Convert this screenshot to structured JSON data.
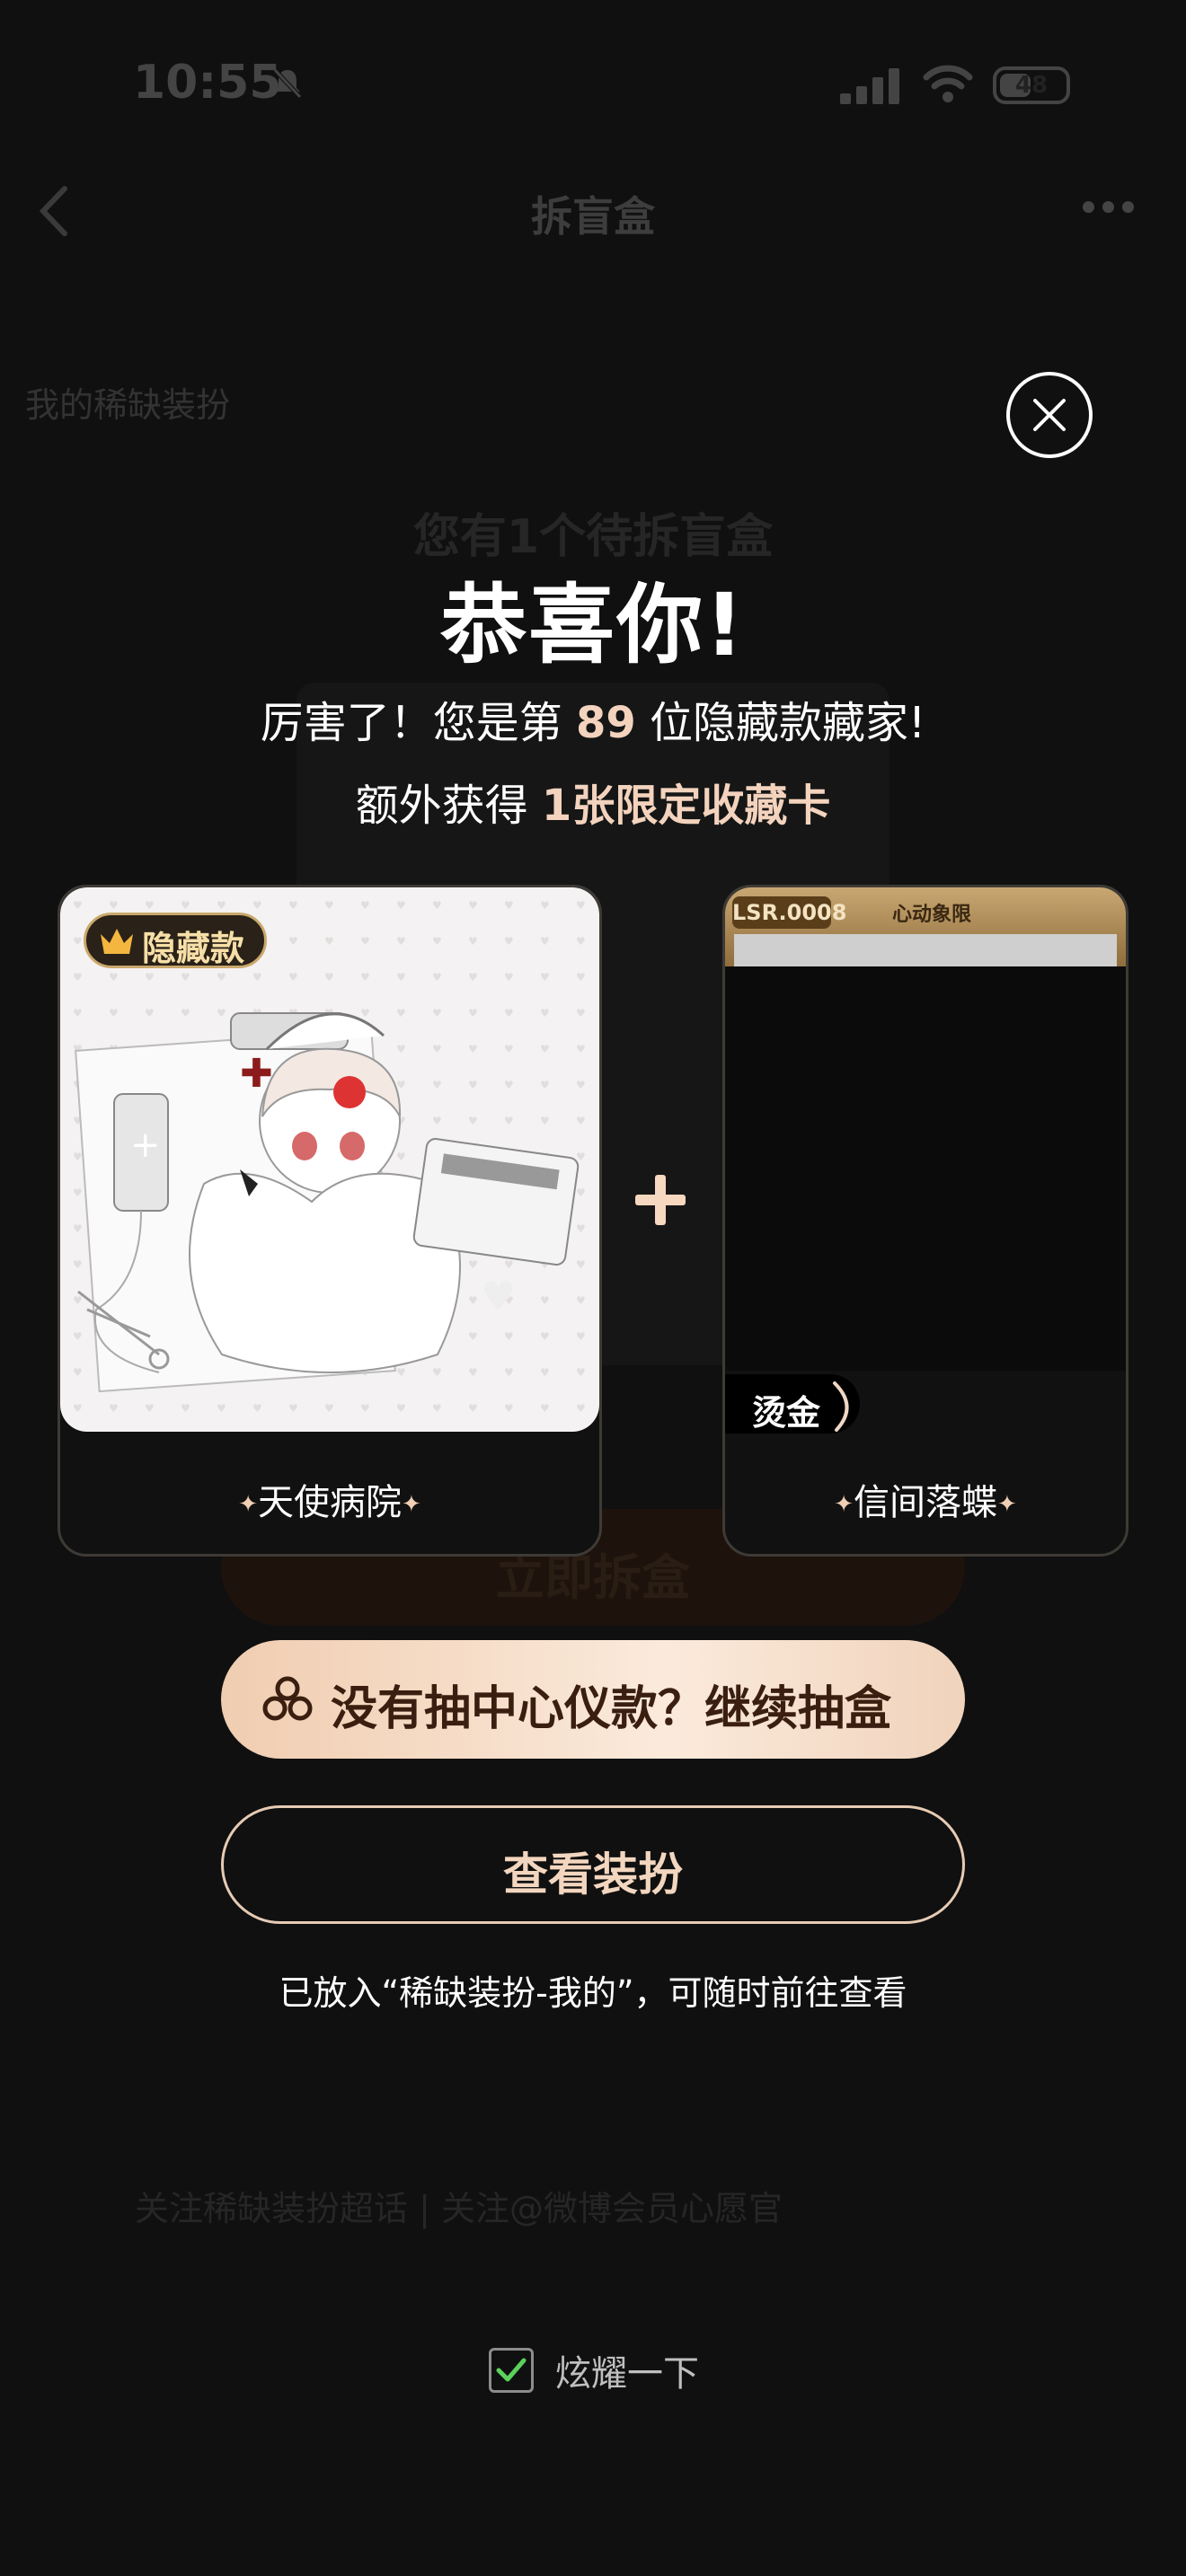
{
  "status_bar": {
    "time": "10:55",
    "battery": "48",
    "battery_level": 0.48
  },
  "nav": {
    "title": "拆盲盒"
  },
  "underlay": {
    "tab_label": "我的稀缺装扮",
    "pending_text": "您有1个待拆盲盒",
    "draw_button": "立即拆盒",
    "footer_text": "关注稀缺装扮超话  |  关注@微博会员心愿官"
  },
  "modal": {
    "title": "恭喜你!",
    "line1_prefix": "厉害了！您是第 ",
    "line1_number": "89",
    "line1_suffix": " 位隐藏款藏家!",
    "line2_prefix": "额外获得 ",
    "line2_highlight": "1张限定收藏卡",
    "left_card": {
      "badge": "隐藏款",
      "name": "天使病院"
    },
    "right_card": {
      "tag": "LSR.0008",
      "brand": "心动象限",
      "foil_label": "烫金",
      "name": "信间落蝶"
    },
    "continue_button": "没有抽中心仪款？继续抽盒",
    "view_button": "查看装扮",
    "note": "已放入“稀缺装扮-我的”，可随时前往查看",
    "show_off_label": "炫耀一下",
    "show_off_checked": true
  },
  "colors": {
    "accent": "#f0cdb1",
    "gold": "#c9a86b",
    "background": "#101010"
  },
  "icons": [
    "bell-off-icon",
    "signal-icon",
    "wifi-icon",
    "battery-icon",
    "back-icon",
    "more-icon",
    "close-icon",
    "crown-icon",
    "plus-icon",
    "sparkle-icon",
    "clover-icon",
    "check-icon"
  ]
}
